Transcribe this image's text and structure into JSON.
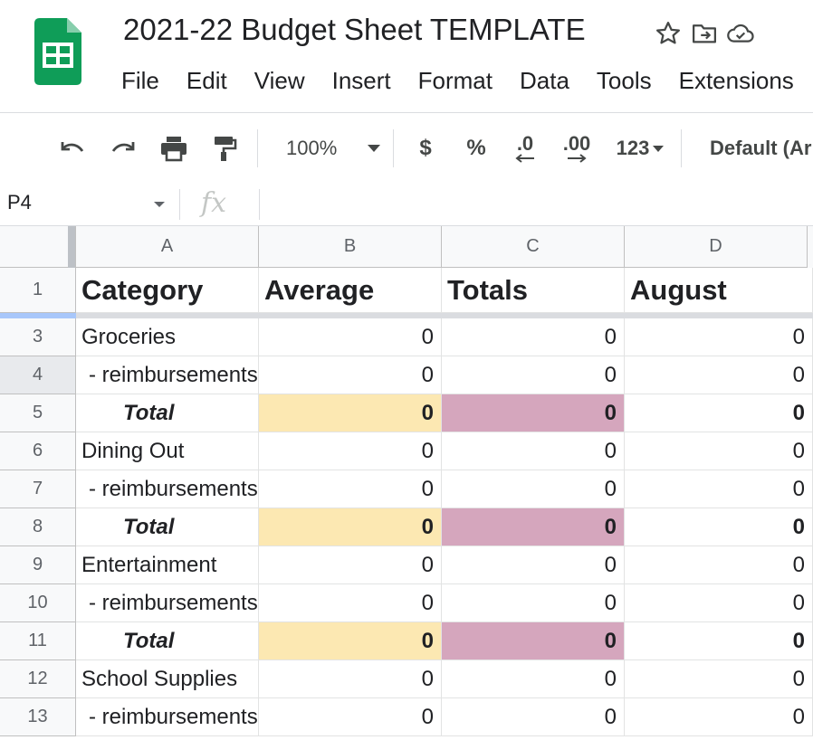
{
  "doc": {
    "title": "2021-22 Budget Sheet TEMPLATE"
  },
  "menu": [
    "File",
    "Edit",
    "View",
    "Insert",
    "Format",
    "Data",
    "Tools",
    "Extensions"
  ],
  "toolbar": {
    "zoom": "100%",
    "currency": "$",
    "percent": "%",
    "decrease_decimal": ".0",
    "increase_decimal": ".00",
    "more_formats": "123",
    "font": "Default (Arial)"
  },
  "formula_bar": {
    "name_box": "P4",
    "fx": "fx",
    "content": ""
  },
  "columns": [
    "A",
    "B",
    "C",
    "D"
  ],
  "header_row": {
    "num": "1",
    "cells": [
      "Category",
      "Average",
      "Totals",
      "August"
    ]
  },
  "rows": [
    {
      "num": "3",
      "type": "category",
      "label": "Groceries",
      "values": [
        "0",
        "0",
        "0"
      ]
    },
    {
      "num": "4",
      "type": "sub",
      "label": "- reimbursements",
      "values": [
        "0",
        "0",
        "0"
      ]
    },
    {
      "num": "5",
      "type": "total",
      "label": "Total",
      "values": [
        "0",
        "0",
        "0"
      ]
    },
    {
      "num": "6",
      "type": "category",
      "label": "Dining Out",
      "values": [
        "0",
        "0",
        "0"
      ]
    },
    {
      "num": "7",
      "type": "sub",
      "label": "- reimbursements",
      "values": [
        "0",
        "0",
        "0"
      ]
    },
    {
      "num": "8",
      "type": "total",
      "label": "Total",
      "values": [
        "0",
        "0",
        "0"
      ]
    },
    {
      "num": "9",
      "type": "category",
      "label": "Entertainment",
      "values": [
        "0",
        "0",
        "0"
      ]
    },
    {
      "num": "10",
      "type": "sub",
      "label": "- reimbursements",
      "values": [
        "0",
        "0",
        "0"
      ]
    },
    {
      "num": "11",
      "type": "total",
      "label": "Total",
      "values": [
        "0",
        "0",
        "0"
      ]
    },
    {
      "num": "12",
      "type": "category",
      "label": "School Supplies",
      "values": [
        "0",
        "0",
        "0"
      ]
    },
    {
      "num": "13",
      "type": "sub",
      "label": "- reimbursements",
      "values": [
        "0",
        "0",
        "0"
      ]
    }
  ],
  "colors": {
    "average_total_fill": "#fce8b2",
    "totals_total_fill": "#d5a6bd",
    "sheets_green": "#0f9d58"
  }
}
